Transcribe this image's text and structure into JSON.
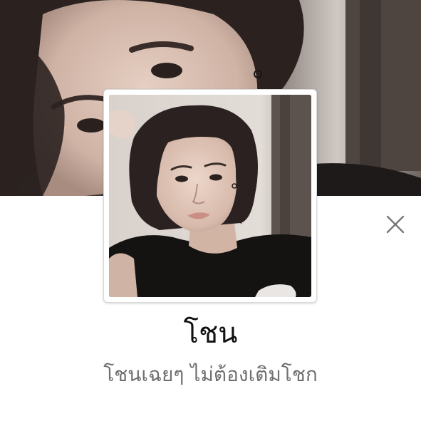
{
  "profile": {
    "name": "โชน",
    "status_message": "โชนเฉยๆ ไม่ต้องเติมโชก"
  },
  "icons": {
    "close": "close-icon"
  },
  "colors": {
    "background": "#ffffff",
    "name_text": "#111111",
    "status_text": "#6f6f6f",
    "close_icon": "#777777"
  }
}
